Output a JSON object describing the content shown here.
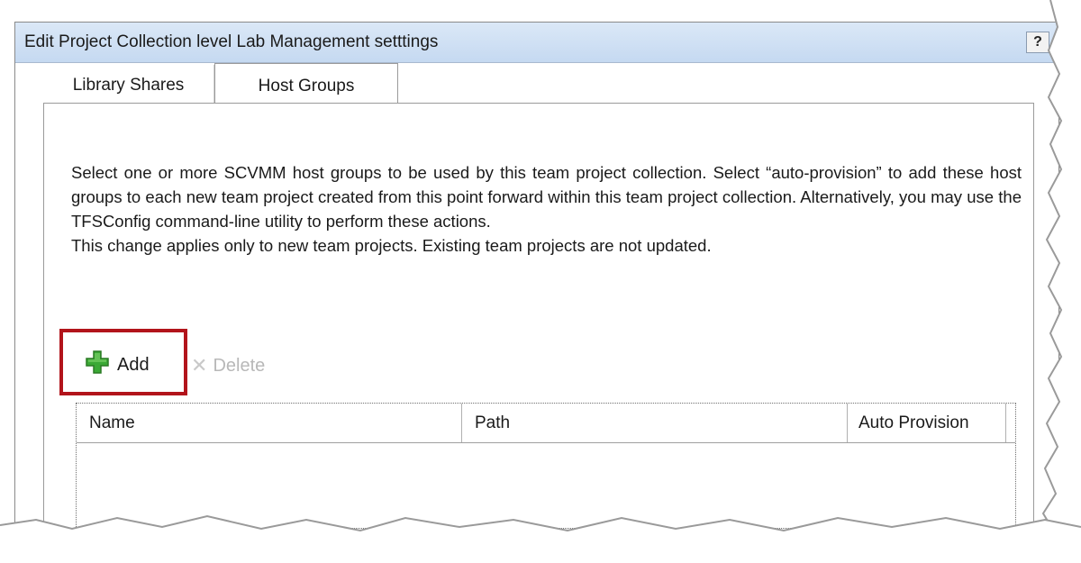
{
  "window": {
    "title": "Edit Project Collection level Lab Management setttings",
    "help_label": "?"
  },
  "tabs": [
    {
      "label": "Library Shares",
      "selected": false
    },
    {
      "label": "Host Groups",
      "selected": true
    }
  ],
  "description": {
    "paragraph1": "Select one or more SCVMM host groups to be used by this team project collection. Select “auto-provision” to add these host groups to each new team project created from this point forward within this team project collection. Alternatively, you may use the TFSConfig command-line utility to perform these actions.",
    "paragraph2": "This change applies only to new team projects. Existing team projects are not updated."
  },
  "toolbar": {
    "add_label": "Add",
    "add_icon": "plus-icon",
    "delete_label": "Delete",
    "delete_icon": "delete-x-icon",
    "delete_enabled": false
  },
  "table": {
    "columns": [
      "Name",
      "Path",
      "Auto Provision"
    ],
    "rows": []
  },
  "colors": {
    "highlight": "#b2141b",
    "add_icon_green": "#3aa935",
    "titlebar": "#c5d9f1"
  }
}
